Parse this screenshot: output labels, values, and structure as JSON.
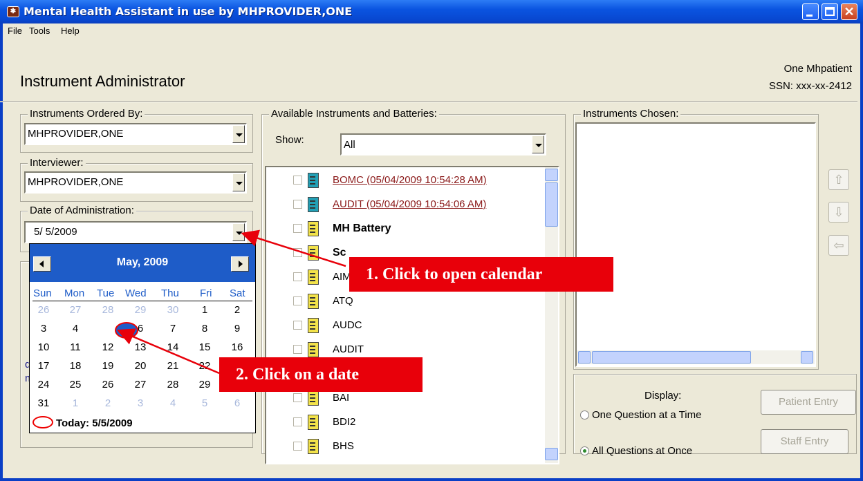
{
  "window": {
    "title": "Mental Health Assistant in use by MHPROVIDER,ONE"
  },
  "menu": [
    "File",
    "Tools",
    "Help"
  ],
  "header": {
    "title": "Instrument Administrator",
    "patient_name": "One Mhpatient",
    "patient_ssn": "SSN: xxx-xx-2412"
  },
  "ordered_by": {
    "label": "Instruments Ordered By:",
    "value": "MHPROVIDER,ONE"
  },
  "interviewer": {
    "label": "Interviewer:",
    "value": "MHPROVIDER,ONE"
  },
  "date_admin": {
    "label": "Date of Administration:",
    "value": "5/ 5/2009"
  },
  "calendar": {
    "month": "May, 2009",
    "dow": [
      "Sun",
      "Mon",
      "Tue",
      "Wed",
      "Thu",
      "Fri",
      "Sat"
    ],
    "weeks": [
      [
        "26",
        "27",
        "28",
        "29",
        "30",
        "1",
        "2"
      ],
      [
        "3",
        "4",
        "5",
        "6",
        "7",
        "8",
        "9"
      ],
      [
        "10",
        "11",
        "12",
        "13",
        "14",
        "15",
        "16"
      ],
      [
        "17",
        "18",
        "19",
        "20",
        "21",
        "22",
        ""
      ],
      [
        "24",
        "25",
        "26",
        "27",
        "28",
        "29",
        ""
      ],
      [
        "31",
        "1",
        "2",
        "3",
        "4",
        "5",
        "6"
      ]
    ],
    "today": "Today: 5/5/2009"
  },
  "available": {
    "label": "Available Instruments and Batteries:",
    "show_label": "Show:",
    "show_value": "All",
    "items": [
      {
        "label": "BOMC  (05/04/2009 10:54:28 AM)",
        "style": "red"
      },
      {
        "label": "AUDIT  (05/04/2009 10:54:06 AM)",
        "style": "red"
      },
      {
        "label": "MH Battery",
        "style": "bold"
      },
      {
        "label": "Sc",
        "style": "bold"
      },
      {
        "label": "AIM",
        "style": "normal"
      },
      {
        "label": "ATQ",
        "style": "normal"
      },
      {
        "label": "AUDC",
        "style": "normal"
      },
      {
        "label": "AUDIT",
        "style": "normal"
      },
      {
        "label": "",
        "style": "normal"
      },
      {
        "label": "BAI",
        "style": "normal"
      },
      {
        "label": "BDI2",
        "style": "normal"
      },
      {
        "label": "BHS",
        "style": "normal"
      }
    ]
  },
  "chosen": {
    "label": "Instruments Chosen:"
  },
  "display": {
    "label": "Display:",
    "option1": "One Question at a Time",
    "option2": "All Questions at Once",
    "patient_entry": "Patient Entry",
    "staff_entry": "Staff Entry"
  },
  "left_panel_text": {
    "a": "d",
    "b": "m"
  },
  "callouts": {
    "c1": "1. Click to open calendar",
    "c2": "2. Click on a date"
  },
  "colors": {
    "title_bar": "#0a54e0",
    "callout": "#e8000a",
    "calendar_header": "#1e5cc8",
    "link_red": "#8b1a1a"
  }
}
